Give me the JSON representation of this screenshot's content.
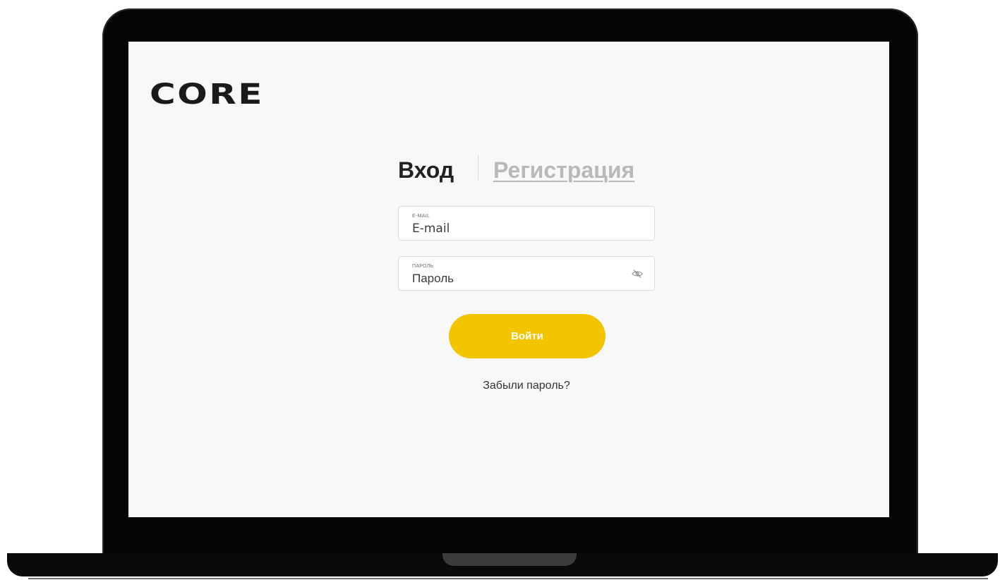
{
  "brand": {
    "logo_text": "CORE"
  },
  "auth_tabs": {
    "login_label": "Вход",
    "register_label": "Регистрация"
  },
  "form": {
    "email": {
      "label": "E-MAIL",
      "placeholder": "E-mail",
      "value": ""
    },
    "password": {
      "label": "ПАРОЛЬ",
      "placeholder": "Пароль",
      "value": "",
      "toggle_icon": "eye-off-icon"
    },
    "submit_label": "Войти",
    "forgot_label": "Забыли пароль?"
  },
  "colors": {
    "accent": "#f2c500",
    "screen_background": "#f8f8f8",
    "inactive_tab": "#b9b9b9",
    "device_frame": "#050505"
  }
}
